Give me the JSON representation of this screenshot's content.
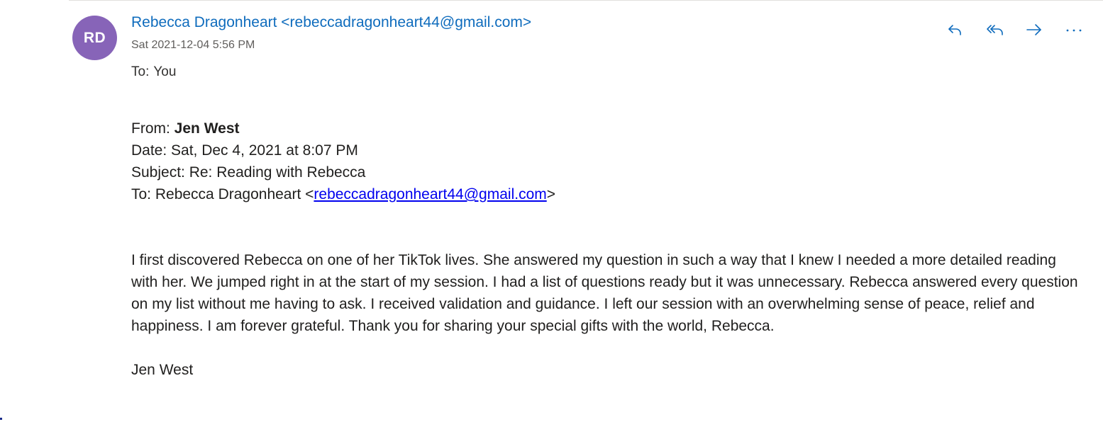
{
  "message": {
    "avatar_initials": "RD",
    "sender": "Rebecca Dragonheart <rebeccadragonheart44@gmail.com>",
    "timestamp": "Sat 2021-12-04 5:56 PM",
    "to_label": "To:",
    "to_value": "You"
  },
  "actions": [
    {
      "name": "reply",
      "icon": "reply-icon"
    },
    {
      "name": "reply-all",
      "icon": "reply-all-icon"
    },
    {
      "name": "forward",
      "icon": "forward-icon"
    },
    {
      "name": "more",
      "icon": "more-actions-icon"
    }
  ],
  "forwarded": {
    "from_label": "From:",
    "from_name": "Jen West",
    "date_line": "Date: Sat, Dec 4, 2021 at 8:07 PM",
    "subject_line": "Subject: Re: Reading with Rebecca",
    "to_prefix": "To: Rebecca Dragonheart <",
    "to_email": "rebeccadragonheart44@gmail.com",
    "to_suffix": ">",
    "body": "I first discovered Rebecca on one of her TikTok lives. She answered my question in such a way that I knew I needed a more detailed reading with her. We jumped right in at the start of my session. I had a list of questions ready but it was unnecessary. Rebecca answered every question on my list without me having to ask. I received validation and guidance. I left our session with an overwhelming sense of peace, relief and happiness. I am forever grateful. Thank you for sharing your special gifts with the world, Rebecca.",
    "signature": "Jen West"
  },
  "colors": {
    "accent": "#0f6cbd",
    "avatar_bg": "#8764b8",
    "link": "#0000ee"
  }
}
